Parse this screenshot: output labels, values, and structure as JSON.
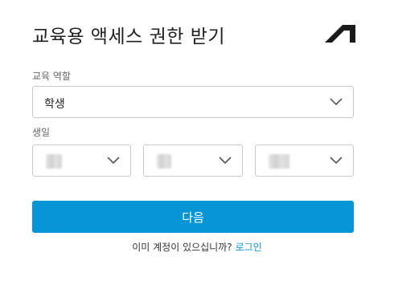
{
  "header": {
    "title": "교육용 액세스 권한 받기"
  },
  "logo": {
    "icon": "autodesk-logo-icon",
    "color": "#1a1a1a"
  },
  "form": {
    "role_label": "교육 역할",
    "role_value": "학생",
    "birth_label": "생일",
    "year_value": "",
    "month_value": "",
    "day_value": ""
  },
  "actions": {
    "next_label": "다음",
    "signin_prompt": "이미 계정이 있으십니까?",
    "signin_link": "로그인"
  },
  "colors": {
    "accent": "#0696d7",
    "border": "#c9c9c9",
    "label": "#666666"
  }
}
